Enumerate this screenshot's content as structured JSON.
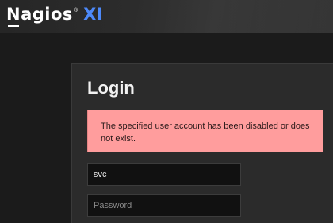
{
  "header": {
    "logo_text": "Nagios",
    "logo_registered": "®",
    "logo_suffix": "XI",
    "logo_suffix_color": "#4d89f9"
  },
  "login": {
    "title": "Login",
    "alert_message": "The specified user account has been disabled or does not exist.",
    "alert_color": "#ff9d9d",
    "username_value": "svc",
    "password_placeholder": "Password"
  }
}
